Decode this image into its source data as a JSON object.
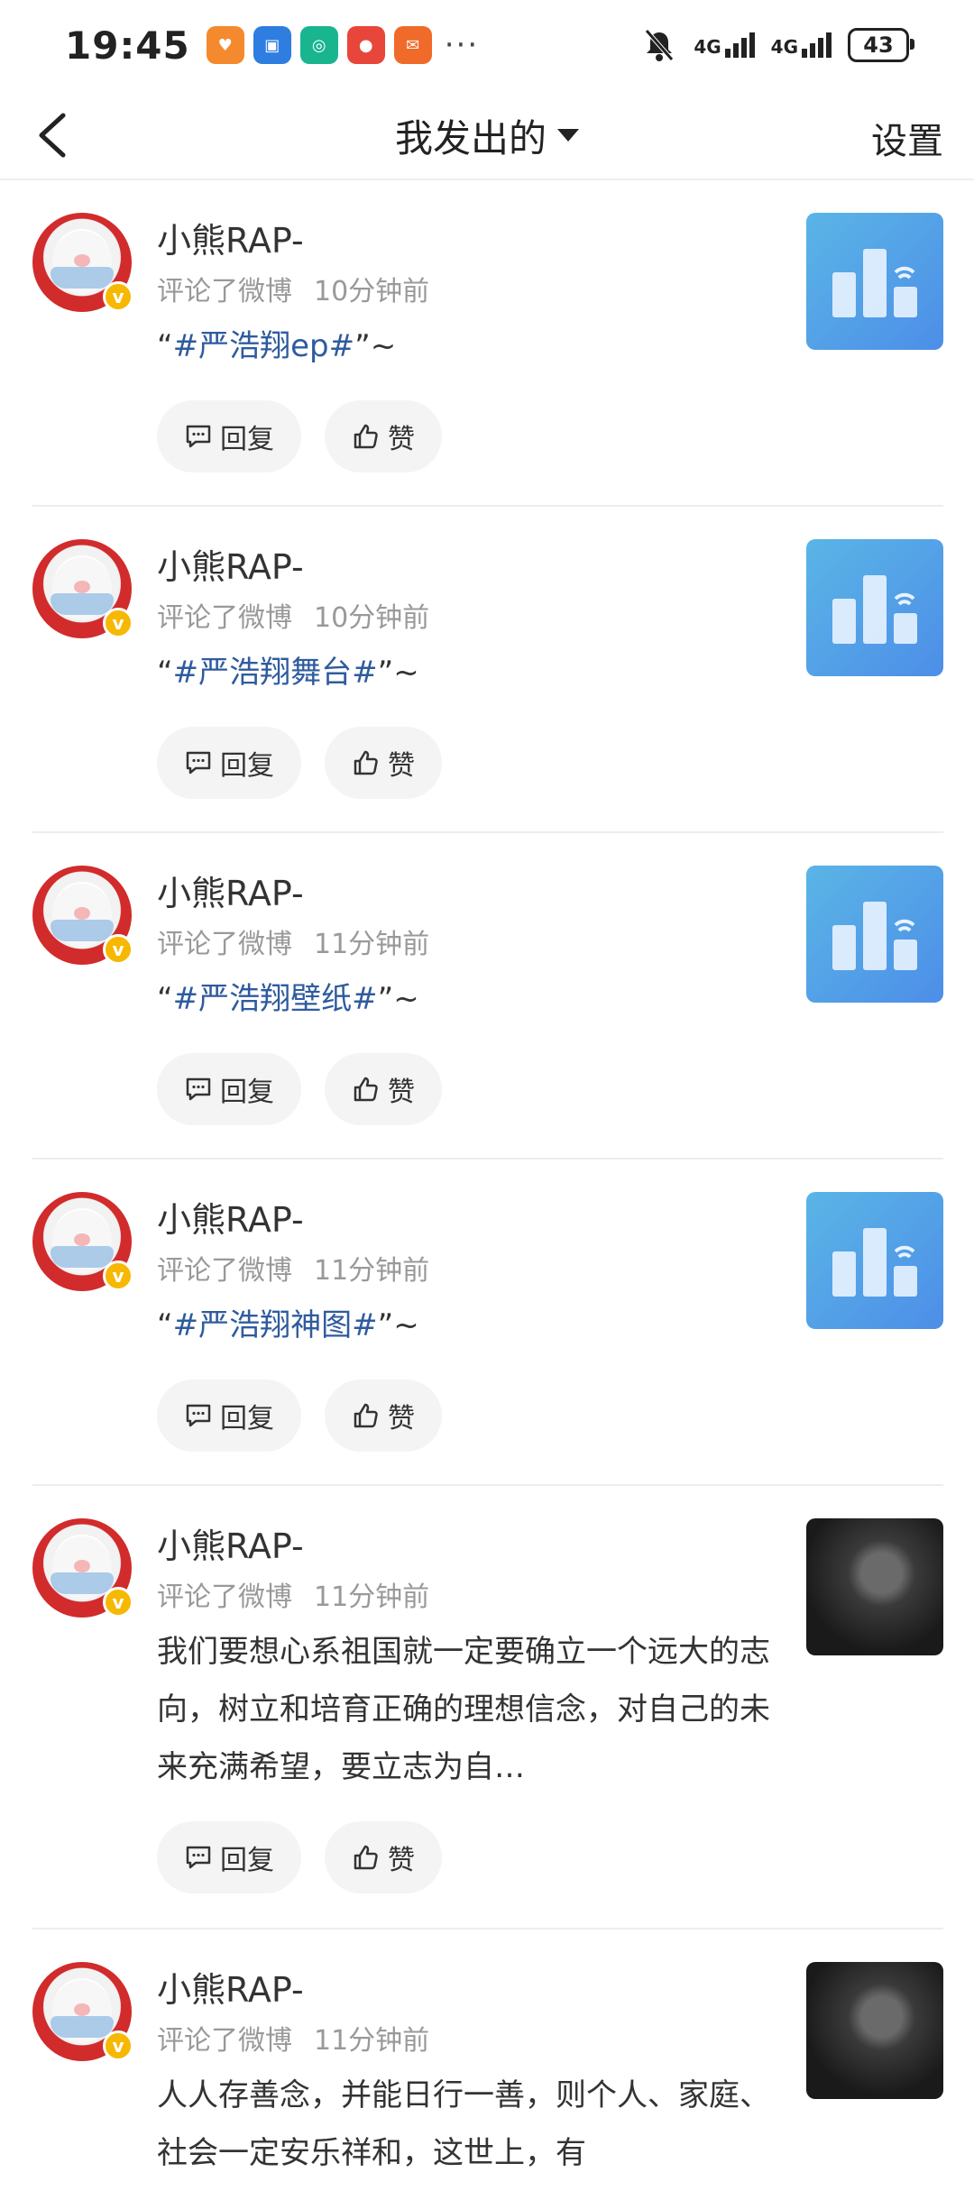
{
  "status_bar": {
    "time": "19:45",
    "app_icons": [
      "heart-app-icon",
      "app-market-icon",
      "ai-app-icon",
      "weibo-icon",
      "red-envelope-icon"
    ],
    "more": "···",
    "network1": "4G",
    "network2": "4G",
    "battery": "43"
  },
  "header": {
    "back_icon": "chevron-left-icon",
    "title": "我发出的",
    "settings": "设置"
  },
  "feed": [
    {
      "name": "小熊RAP-",
      "action": "评论了微博",
      "time": "10分钟前",
      "pre": "“",
      "tag": "#严浩翔ep#",
      "post": "”~",
      "thumb": "bar-chart-thumb",
      "reply": "回复",
      "like": "赞"
    },
    {
      "name": "小熊RAP-",
      "action": "评论了微博",
      "time": "10分钟前",
      "pre": "“",
      "tag": "#严浩翔舞台#",
      "post": "”~",
      "thumb": "bar-chart-thumb",
      "reply": "回复",
      "like": "赞"
    },
    {
      "name": "小熊RAP-",
      "action": "评论了微博",
      "time": "11分钟前",
      "pre": "“",
      "tag": "#严浩翔壁纸#",
      "post": "”~",
      "thumb": "bar-chart-thumb",
      "reply": "回复",
      "like": "赞"
    },
    {
      "name": "小熊RAP-",
      "action": "评论了微博",
      "time": "11分钟前",
      "pre": "“",
      "tag": "#严浩翔神图#",
      "post": "”~",
      "thumb": "bar-chart-thumb",
      "reply": "回复",
      "like": "赞"
    },
    {
      "name": "小熊RAP-",
      "action": "评论了微博",
      "time": "11分钟前",
      "text": "我们要想心系祖国就一定要确立一个远大的志向，树立和培育正确的理想信念，对自己的未来充满希望，要立志为自…",
      "thumb": "photo-thumb",
      "reply": "回复",
      "like": "赞"
    },
    {
      "name": "小熊RAP-",
      "action": "评论了微博",
      "time": "11分钟前",
      "text": "人人存善念，并能日行一善，则个人、家庭、社会一定安乐祥和，这世上，有",
      "thumb": "photo-thumb"
    }
  ],
  "colors": {
    "tag": "#2f5b9e",
    "badge": "#f6b800",
    "thumb_blue": "#4d8ee8"
  }
}
